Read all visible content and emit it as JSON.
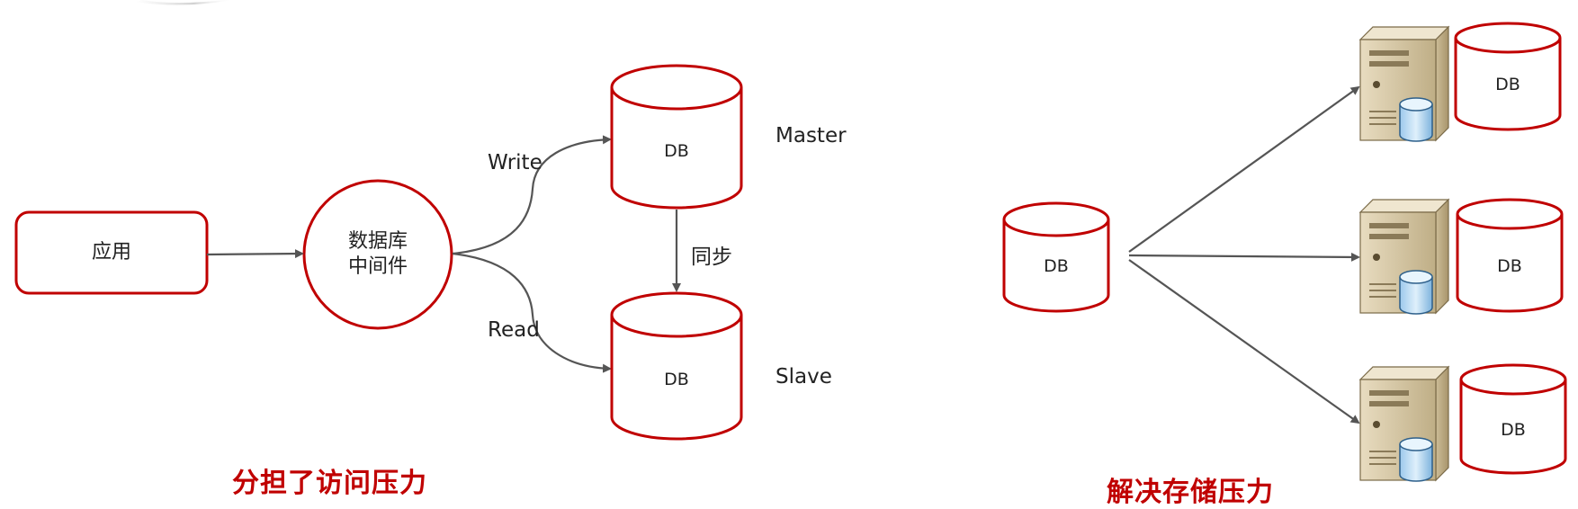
{
  "colors": {
    "accent": "#c00000",
    "arrow": "#555555",
    "text": "#222222"
  },
  "left": {
    "app_label": "应用",
    "middleware_line1": "数据库",
    "middleware_line2": "中间件",
    "write_label": "Write",
    "read_label": "Read",
    "sync_label": "同步",
    "master_db": "DB",
    "slave_db": "DB",
    "master_label": "Master",
    "slave_label": "Slave",
    "caption": "分担了访问压力"
  },
  "right": {
    "source_db": "DB",
    "shards": [
      "DB",
      "DB",
      "DB"
    ],
    "server_icon": "server-icon",
    "caption": "解决存储压力"
  }
}
